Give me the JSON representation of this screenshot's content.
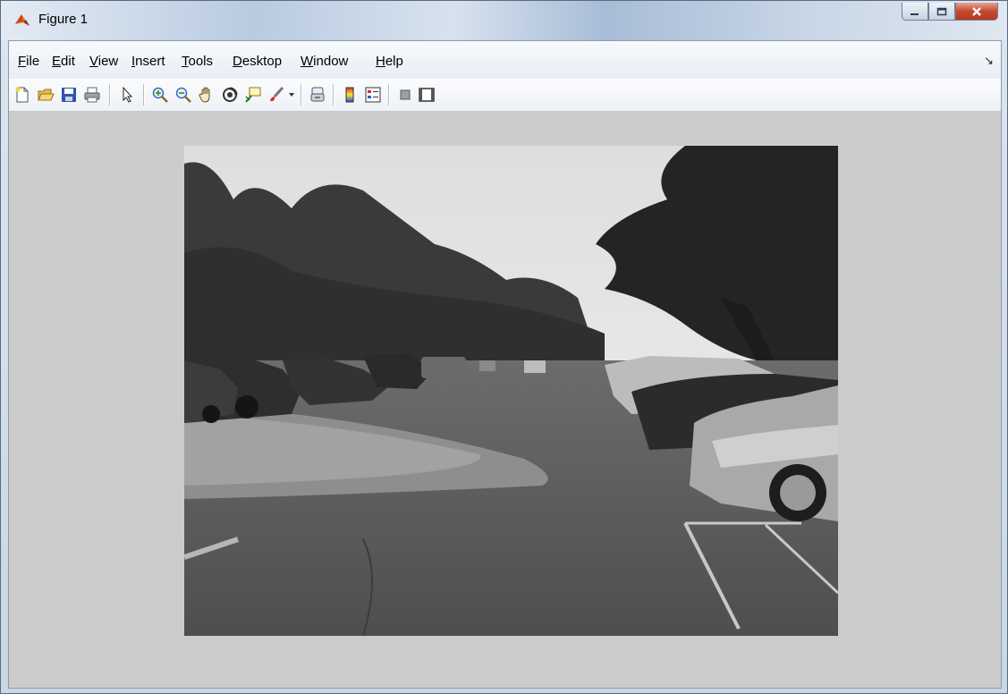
{
  "window": {
    "title": "Figure 1"
  },
  "menu": [
    {
      "key": "F",
      "rest": "ile"
    },
    {
      "key": "E",
      "rest": "dit"
    },
    {
      "key": "V",
      "rest": "iew"
    },
    {
      "key": "I",
      "rest": "nsert"
    },
    {
      "key": "T",
      "rest": "ools"
    },
    {
      "key": "D",
      "rest": "esktop"
    },
    {
      "key": "W",
      "rest": "indow"
    },
    {
      "key": "H",
      "rest": "elp"
    }
  ],
  "toolbar_icons": [
    "new-figure-icon",
    "open-file-icon",
    "save-icon",
    "print-icon",
    "edit-plot-arrow-icon",
    "zoom-in-icon",
    "zoom-out-icon",
    "pan-hand-icon",
    "rotate-3d-icon",
    "data-cursor-icon",
    "brush-icon",
    "link-plot-icon",
    "colorbar-icon",
    "legend-icon",
    "hide-plot-tools-icon",
    "show-plot-tools-icon"
  ],
  "colors": {
    "accent_close": "#c54a2f",
    "figure_bg": "#cccccc"
  }
}
